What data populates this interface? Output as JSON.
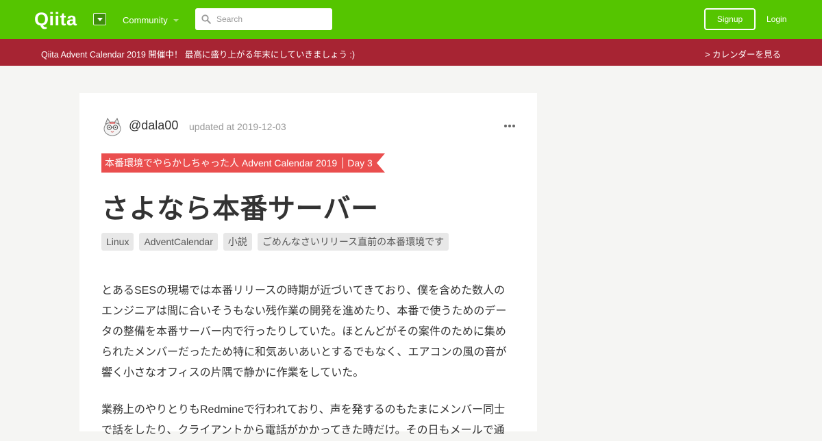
{
  "header": {
    "logo": "Qiita",
    "community_label": "Community",
    "search_placeholder": "Search",
    "signup_label": "Signup",
    "login_label": "Login",
    "brand_color": "#55c500"
  },
  "banner": {
    "text": "Qiita Advent Calendar 2019 開催中！ 最高に盛り上がる年末にしていきましょう :)",
    "link": "> カレンダーを見る",
    "color": "#a72433"
  },
  "article": {
    "author": "@dala00",
    "updated": "updated at 2019-12-03",
    "calendar": {
      "name": "本番環境でやらかしちゃった人 Advent Calendar 2019",
      "day": "Day 3",
      "color": "#ea4e4e"
    },
    "title": "さよなら本番サーバー",
    "tags": [
      "Linux",
      "AdventCalendar",
      "小説",
      "ごめんなさいリリース直前の本番環境です"
    ],
    "paragraphs": [
      "とあるSESの現場では本番リリースの時期が近づいてきており、僕を含めた数人のエンジニアは間に合いそうもない残作業の開発を進めたり、本番で使うためのデータの整備を本番サーバー内で行ったりしていた。ほとんどがその案件のために集められたメンバーだったため特に和気あいあいとするでもなく、エアコンの風の音が響く小さなオフィスの片隅で静かに作業をしていた。",
      "業務上のやりとりもRedmineで行われており、声を発するのもたまにメンバー同士で話をしたり、クライアントから電話がかかってきた時だけ。その日もメールで通"
    ]
  }
}
